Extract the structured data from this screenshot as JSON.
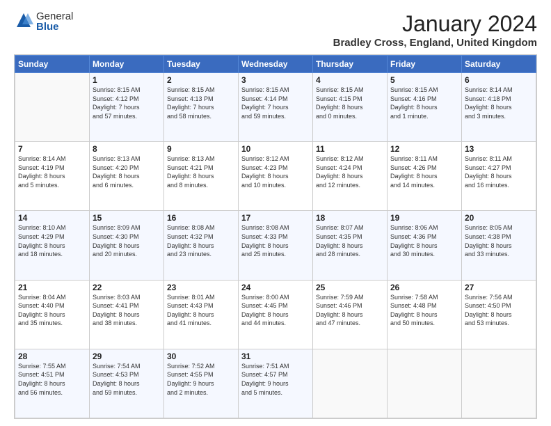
{
  "logo": {
    "general": "General",
    "blue": "Blue"
  },
  "title": "January 2024",
  "location": "Bradley Cross, England, United Kingdom",
  "days_header": [
    "Sunday",
    "Monday",
    "Tuesday",
    "Wednesday",
    "Thursday",
    "Friday",
    "Saturday"
  ],
  "weeks": [
    [
      {
        "day": "",
        "info": ""
      },
      {
        "day": "1",
        "info": "Sunrise: 8:15 AM\nSunset: 4:12 PM\nDaylight: 7 hours\nand 57 minutes."
      },
      {
        "day": "2",
        "info": "Sunrise: 8:15 AM\nSunset: 4:13 PM\nDaylight: 7 hours\nand 58 minutes."
      },
      {
        "day": "3",
        "info": "Sunrise: 8:15 AM\nSunset: 4:14 PM\nDaylight: 7 hours\nand 59 minutes."
      },
      {
        "day": "4",
        "info": "Sunrise: 8:15 AM\nSunset: 4:15 PM\nDaylight: 8 hours\nand 0 minutes."
      },
      {
        "day": "5",
        "info": "Sunrise: 8:15 AM\nSunset: 4:16 PM\nDaylight: 8 hours\nand 1 minute."
      },
      {
        "day": "6",
        "info": "Sunrise: 8:14 AM\nSunset: 4:18 PM\nDaylight: 8 hours\nand 3 minutes."
      }
    ],
    [
      {
        "day": "7",
        "info": "Sunrise: 8:14 AM\nSunset: 4:19 PM\nDaylight: 8 hours\nand 5 minutes."
      },
      {
        "day": "8",
        "info": "Sunrise: 8:13 AM\nSunset: 4:20 PM\nDaylight: 8 hours\nand 6 minutes."
      },
      {
        "day": "9",
        "info": "Sunrise: 8:13 AM\nSunset: 4:21 PM\nDaylight: 8 hours\nand 8 minutes."
      },
      {
        "day": "10",
        "info": "Sunrise: 8:12 AM\nSunset: 4:23 PM\nDaylight: 8 hours\nand 10 minutes."
      },
      {
        "day": "11",
        "info": "Sunrise: 8:12 AM\nSunset: 4:24 PM\nDaylight: 8 hours\nand 12 minutes."
      },
      {
        "day": "12",
        "info": "Sunrise: 8:11 AM\nSunset: 4:26 PM\nDaylight: 8 hours\nand 14 minutes."
      },
      {
        "day": "13",
        "info": "Sunrise: 8:11 AM\nSunset: 4:27 PM\nDaylight: 8 hours\nand 16 minutes."
      }
    ],
    [
      {
        "day": "14",
        "info": "Sunrise: 8:10 AM\nSunset: 4:29 PM\nDaylight: 8 hours\nand 18 minutes."
      },
      {
        "day": "15",
        "info": "Sunrise: 8:09 AM\nSunset: 4:30 PM\nDaylight: 8 hours\nand 20 minutes."
      },
      {
        "day": "16",
        "info": "Sunrise: 8:08 AM\nSunset: 4:32 PM\nDaylight: 8 hours\nand 23 minutes."
      },
      {
        "day": "17",
        "info": "Sunrise: 8:08 AM\nSunset: 4:33 PM\nDaylight: 8 hours\nand 25 minutes."
      },
      {
        "day": "18",
        "info": "Sunrise: 8:07 AM\nSunset: 4:35 PM\nDaylight: 8 hours\nand 28 minutes."
      },
      {
        "day": "19",
        "info": "Sunrise: 8:06 AM\nSunset: 4:36 PM\nDaylight: 8 hours\nand 30 minutes."
      },
      {
        "day": "20",
        "info": "Sunrise: 8:05 AM\nSunset: 4:38 PM\nDaylight: 8 hours\nand 33 minutes."
      }
    ],
    [
      {
        "day": "21",
        "info": "Sunrise: 8:04 AM\nSunset: 4:40 PM\nDaylight: 8 hours\nand 35 minutes."
      },
      {
        "day": "22",
        "info": "Sunrise: 8:03 AM\nSunset: 4:41 PM\nDaylight: 8 hours\nand 38 minutes."
      },
      {
        "day": "23",
        "info": "Sunrise: 8:01 AM\nSunset: 4:43 PM\nDaylight: 8 hours\nand 41 minutes."
      },
      {
        "day": "24",
        "info": "Sunrise: 8:00 AM\nSunset: 4:45 PM\nDaylight: 8 hours\nand 44 minutes."
      },
      {
        "day": "25",
        "info": "Sunrise: 7:59 AM\nSunset: 4:46 PM\nDaylight: 8 hours\nand 47 minutes."
      },
      {
        "day": "26",
        "info": "Sunrise: 7:58 AM\nSunset: 4:48 PM\nDaylight: 8 hours\nand 50 minutes."
      },
      {
        "day": "27",
        "info": "Sunrise: 7:56 AM\nSunset: 4:50 PM\nDaylight: 8 hours\nand 53 minutes."
      }
    ],
    [
      {
        "day": "28",
        "info": "Sunrise: 7:55 AM\nSunset: 4:51 PM\nDaylight: 8 hours\nand 56 minutes."
      },
      {
        "day": "29",
        "info": "Sunrise: 7:54 AM\nSunset: 4:53 PM\nDaylight: 8 hours\nand 59 minutes."
      },
      {
        "day": "30",
        "info": "Sunrise: 7:52 AM\nSunset: 4:55 PM\nDaylight: 9 hours\nand 2 minutes."
      },
      {
        "day": "31",
        "info": "Sunrise: 7:51 AM\nSunset: 4:57 PM\nDaylight: 9 hours\nand 5 minutes."
      },
      {
        "day": "",
        "info": ""
      },
      {
        "day": "",
        "info": ""
      },
      {
        "day": "",
        "info": ""
      }
    ]
  ]
}
